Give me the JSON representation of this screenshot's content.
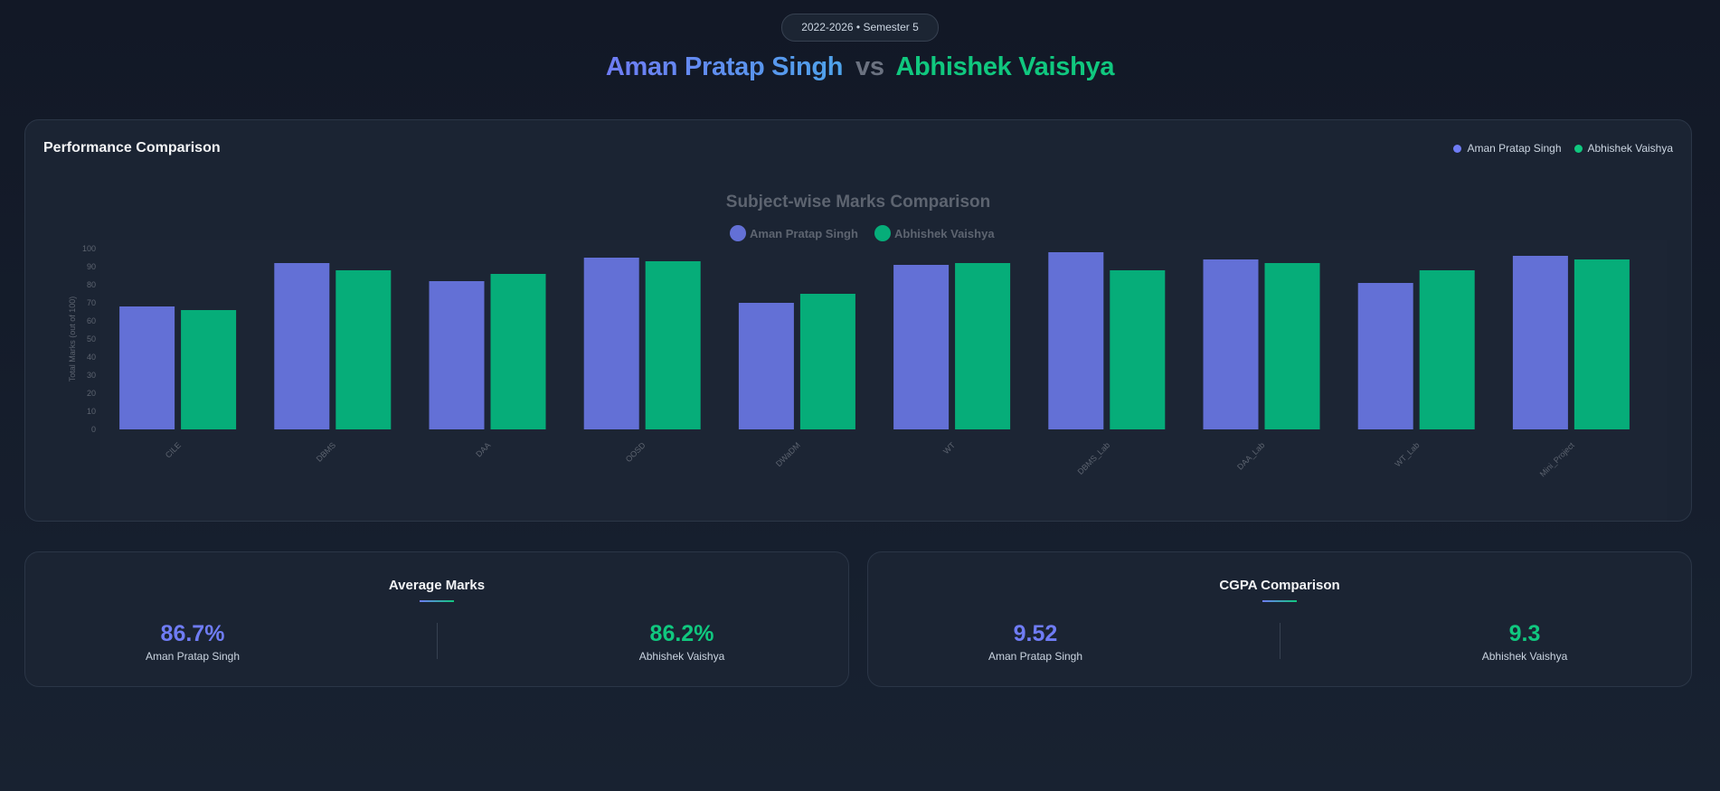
{
  "header": {
    "badge": "2022-2026 • Semester 5",
    "student_a": "Aman Pratap Singh",
    "vs": "vs",
    "student_b": "Abhishek Vaishya"
  },
  "performance_card": {
    "title": "Performance Comparison",
    "legend": [
      "Aman Pratap Singh",
      "Abhishek Vaishya"
    ]
  },
  "colors": {
    "student_a": "#6370d6",
    "student_b": "#06ad79"
  },
  "chart_data": {
    "type": "bar",
    "title": "Subject-wise Marks Comparison",
    "xlabel": "",
    "ylabel": "Total Marks (out of 100)",
    "ylim": [
      0,
      100
    ],
    "yticks": [
      0,
      10,
      20,
      30,
      40,
      50,
      60,
      70,
      80,
      90,
      100
    ],
    "grid": false,
    "legend_position": "top-center",
    "categories": [
      "CILE",
      "DBMS",
      "DAA",
      "OOSD",
      "DWaDM",
      "WT",
      "DBMS_Lab",
      "DAA_Lab",
      "WT_Lab",
      "Mini_Project"
    ],
    "series": [
      {
        "name": "Aman Pratap Singh",
        "values": [
          68,
          92,
          82,
          95,
          70,
          91,
          98,
          94,
          81,
          96
        ]
      },
      {
        "name": "Abhishek Vaishya",
        "values": [
          66,
          88,
          86,
          93,
          75,
          92,
          88,
          92,
          88,
          94
        ]
      }
    ]
  },
  "average_card": {
    "title": "Average Marks",
    "a_value": "86.7%",
    "a_label": "Aman Pratap Singh",
    "b_value": "86.2%",
    "b_label": "Abhishek Vaishya"
  },
  "cgpa_card": {
    "title": "CGPA Comparison",
    "a_value": "9.52",
    "a_label": "Aman Pratap Singh",
    "b_value": "9.3",
    "b_label": "Abhishek Vaishya"
  }
}
